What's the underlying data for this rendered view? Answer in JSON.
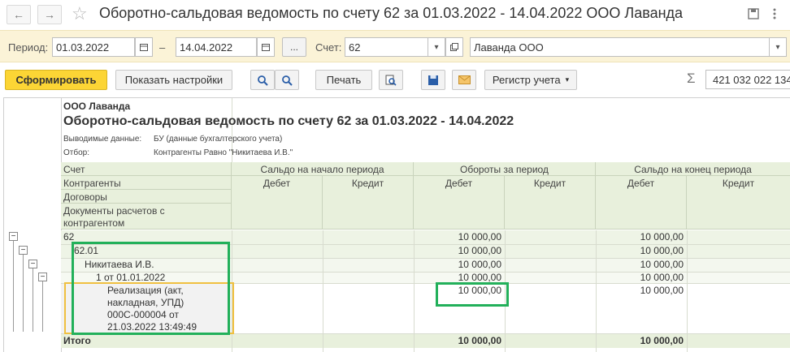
{
  "window": {
    "title": "Оборотно-сальдовая ведомость по счету 62 за 01.03.2022 - 14.04.2022 ООО Лаванда",
    "back_glyph": "←",
    "forward_glyph": "→",
    "favorite_glyph": "☆"
  },
  "filters": {
    "period_label": "Период:",
    "date_from": "01.03.2022",
    "dash": "–",
    "date_to": "14.04.2022",
    "dots_label": "...",
    "account_label": "Счет:",
    "account_value": "62",
    "org_value": "Лаванда ООО"
  },
  "toolbar": {
    "generate_label": "Сформировать",
    "settings_label": "Показать настройки",
    "print_label": "Печать",
    "register_label": "Регистр учета",
    "sum_value": "421 032 022 134"
  },
  "report": {
    "org_name": "ООО Лаванда",
    "title": "Оборотно-сальдовая ведомость по счету 62 за 01.03.2022 - 14.04.2022",
    "output_label": "Выводимые данные:",
    "output_value": "БУ (данные бухгалтерского учета)",
    "filter_label": "Отбор:",
    "filter_value": "Контрагенты Равно \"Никитаева И.В.\"",
    "columns": {
      "account": "Счет",
      "counterparties": "Контрагенты",
      "contracts": "Договоры",
      "documents_line1": "Документы расчетов с",
      "documents_line2": "контрагентом",
      "opening_balance": "Сальдо на начало периода",
      "turnover": "Обороты за период",
      "closing_balance": "Сальдо на конец периода",
      "debit": "Дебет",
      "credit": "Кредит"
    },
    "rows": [
      {
        "label": "62",
        "turnover_debit": "10 000,00",
        "closing_debit": "10 000,00"
      },
      {
        "label": "62.01",
        "turnover_debit": "10 000,00",
        "closing_debit": "10 000,00"
      },
      {
        "label": "Никитаева И.В.",
        "turnover_debit": "10 000,00",
        "closing_debit": "10 000,00"
      },
      {
        "label": "1 от 01.01.2022",
        "turnover_debit": "10 000,00",
        "closing_debit": "10 000,00"
      },
      {
        "label_lines": [
          "Реализация (акт,",
          "накладная, УПД)",
          "000С-000004 от",
          "21.03.2022 13:49:49"
        ],
        "turnover_debit": "10 000,00",
        "closing_debit": "10 000,00"
      }
    ],
    "total": {
      "label": "Итого",
      "turnover_debit": "10 000,00",
      "closing_debit": "10 000,00"
    },
    "tree_glyph": "−"
  },
  "colors": {
    "filter_bg": "#fbf3d7",
    "primary_button": "#fcd535",
    "header_bg": "#e8f0dc",
    "highlight_green": "#22b05a",
    "highlight_yellow": "#f0c040"
  }
}
